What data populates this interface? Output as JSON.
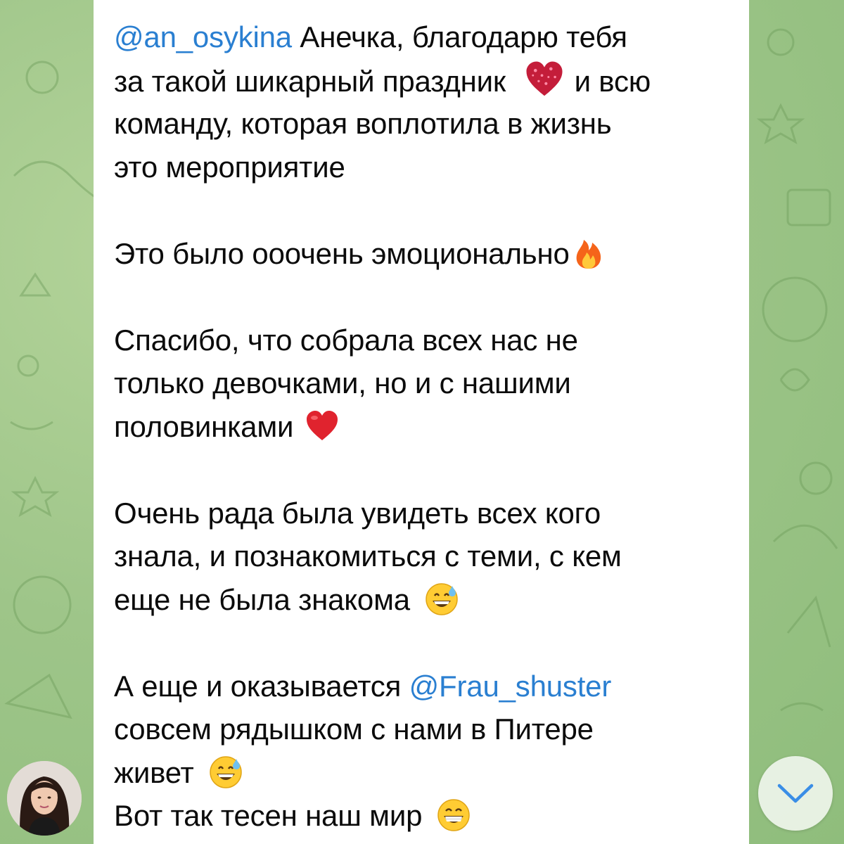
{
  "message": {
    "line1": {
      "mention": "@an_osykina",
      "text": " Анечка, благодарю тебя"
    },
    "line2": {
      "text": "за такой шикарный праздник",
      "emoji": "sparkling-heart",
      "after": "и всю"
    },
    "line3": "команду, которая воплотила в жизнь",
    "line4": "это мероприятие",
    "line5": {
      "text": "Это было ооочень эмоционально",
      "emoji": "fire"
    },
    "line6": "Спасибо, что собрала всех нас не",
    "line7": "только девочками, но и с нашими",
    "line8": {
      "text": "половинками",
      "emoji": "red-heart"
    },
    "line9": "Очень рада была увидеть всех кого",
    "line10": "знала, и познакомиться с теми, с кем",
    "line11": {
      "text": "еще не была знакома",
      "emoji": "grinning-sweat"
    },
    "line12": {
      "text": "А еще и оказывается ",
      "mention": "@Frau_shuster"
    },
    "line13": "совсем рядышком с нами в Питере",
    "line14": {
      "text": "живет",
      "emoji": "grinning-sweat"
    },
    "line15": {
      "text": "Вот так тесен наш мир",
      "emoji": "beaming-grin"
    }
  },
  "colors": {
    "mention": "#2a7fd1",
    "background": "#9ec589",
    "bubble": "#ffffff"
  },
  "icons": {
    "scroll_down": "chevron-down-icon",
    "avatar": "user-avatar"
  }
}
